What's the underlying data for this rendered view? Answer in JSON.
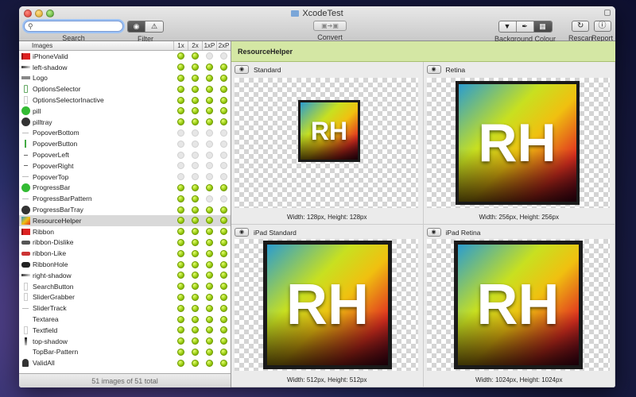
{
  "window": {
    "title": "XcodeTest"
  },
  "toolbar": {
    "search_caption": "Search",
    "search_placeholder": "",
    "filter_caption": "Filter",
    "convert_caption": "Convert",
    "bg_caption": "Background Colour",
    "rescan_caption": "Rescan",
    "report_caption": "Report"
  },
  "sidebar": {
    "col_images": "Images",
    "col_1x": "1x",
    "col_2x": "2x",
    "col_1xp": "1xP",
    "col_2xp": "2xP",
    "footer": "51 images of 51 total",
    "rows": [
      {
        "name": "iPhoneValid",
        "icon": "red-flag",
        "d": [
          1,
          1,
          0,
          0
        ]
      },
      {
        "name": "left-shadow",
        "icon": "gray-bar",
        "d": [
          1,
          1,
          1,
          1
        ]
      },
      {
        "name": "Logo",
        "icon": "logo-text",
        "d": [
          1,
          1,
          1,
          1
        ]
      },
      {
        "name": "OptionsSelector",
        "icon": "outline-rect",
        "d": [
          1,
          1,
          1,
          1
        ]
      },
      {
        "name": "OptionsSelectorInactive",
        "icon": "thin-rect",
        "d": [
          1,
          1,
          1,
          1
        ]
      },
      {
        "name": "pill",
        "icon": "green-circle",
        "d": [
          1,
          1,
          1,
          1
        ]
      },
      {
        "name": "pilltray",
        "icon": "dark-circle",
        "d": [
          1,
          1,
          1,
          1
        ]
      },
      {
        "name": "PopoverBottom",
        "icon": "thin-line",
        "d": [
          0,
          0,
          0,
          0
        ]
      },
      {
        "name": "PopoverButton",
        "icon": "green-line",
        "d": [
          0,
          0,
          0,
          0
        ]
      },
      {
        "name": "PopoverLeft",
        "icon": "dash",
        "d": [
          0,
          0,
          0,
          0
        ]
      },
      {
        "name": "PopoverRight",
        "icon": "dash",
        "d": [
          0,
          0,
          0,
          0
        ]
      },
      {
        "name": "PopoverTop",
        "icon": "thin-line",
        "d": [
          0,
          0,
          0,
          0
        ]
      },
      {
        "name": "ProgressBar",
        "icon": "green-circle",
        "d": [
          1,
          1,
          1,
          1
        ]
      },
      {
        "name": "ProgressBarPattern",
        "icon": "thin-line",
        "d": [
          1,
          1,
          0,
          0
        ]
      },
      {
        "name": "ProgressBarTray",
        "icon": "dark-circle",
        "d": [
          1,
          1,
          1,
          1
        ]
      },
      {
        "name": "ResourceHelper",
        "icon": "rh",
        "d": [
          1,
          1,
          1,
          1
        ]
      },
      {
        "name": "Ribbon",
        "icon": "red-flag",
        "d": [
          1,
          1,
          1,
          1
        ]
      },
      {
        "name": "ribbon-Dislike",
        "icon": "dark-bar",
        "d": [
          1,
          1,
          1,
          1
        ]
      },
      {
        "name": "ribbon-Like",
        "icon": "red-bar",
        "d": [
          1,
          1,
          1,
          1
        ]
      },
      {
        "name": "RibbonHole",
        "icon": "black-bar",
        "d": [
          1,
          1,
          1,
          1
        ]
      },
      {
        "name": "right-shadow",
        "icon": "gray-bar",
        "d": [
          1,
          1,
          1,
          1
        ]
      },
      {
        "name": "SearchButton",
        "icon": "thin-rect",
        "d": [
          1,
          1,
          1,
          1
        ]
      },
      {
        "name": "SliderGrabber",
        "icon": "thin-rect",
        "d": [
          1,
          1,
          1,
          1
        ]
      },
      {
        "name": "SliderTrack",
        "icon": "thin-line",
        "d": [
          1,
          1,
          1,
          1
        ]
      },
      {
        "name": "Textarea",
        "icon": "blank",
        "d": [
          1,
          1,
          1,
          1
        ]
      },
      {
        "name": "Textfield",
        "icon": "thin-rect",
        "d": [
          1,
          1,
          1,
          1
        ]
      },
      {
        "name": "top-shadow",
        "icon": "dark-grad",
        "d": [
          1,
          1,
          1,
          1
        ]
      },
      {
        "name": "TopBar-Pattern",
        "icon": "blank",
        "d": [
          1,
          1,
          1,
          1
        ]
      },
      {
        "name": "ValidAll",
        "icon": "person",
        "d": [
          1,
          1,
          1,
          1
        ]
      }
    ]
  },
  "detail": {
    "title": "ResourceHelper",
    "icon_text": "RH",
    "panes": [
      {
        "label": "Standard",
        "dims": "Width: 128px, Height: 128px"
      },
      {
        "label": "Retina",
        "dims": "Width: 256px, Height: 256px"
      },
      {
        "label": "iPad Standard",
        "dims": "Width: 512px, Height: 512px"
      },
      {
        "label": "iPad Retina",
        "dims": "Width: 1024px, Height: 1024px"
      }
    ]
  }
}
